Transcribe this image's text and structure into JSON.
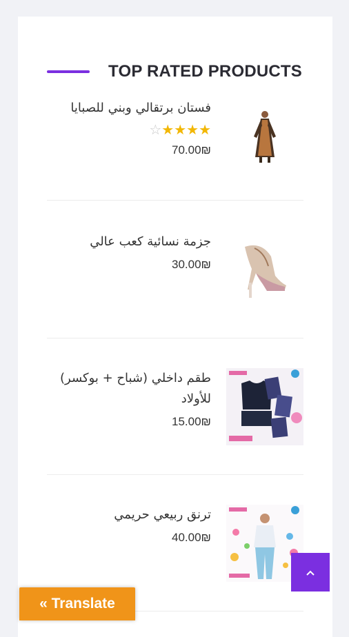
{
  "widget": {
    "title": "TOP RATED PRODUCTS"
  },
  "products": [
    {
      "name": "فستان برتقالي وبني للصبايا",
      "rating": 4,
      "rating_max": 5,
      "price": "70.00₪",
      "image_icon": "dress-image"
    },
    {
      "name": "جزمة نسائية كعب عالي",
      "price": "30.00₪",
      "image_icon": "high-heel-shoe-image"
    },
    {
      "name": "طقم داخلي (شباح + بوكسر) للأولاد",
      "price": "15.00₪",
      "image_icon": "kids-underwear-set-image"
    },
    {
      "name": "ترنق ربيعي حريمي",
      "price": "40.00₪",
      "image_icon": "tracksuit-image"
    }
  ],
  "translate_button": {
    "label": "« Translate"
  },
  "scroll_top": {
    "icon": "chevron-up-icon"
  },
  "colors": {
    "accent": "#7b2fe0",
    "translate_bg": "#f09419",
    "star": "#f2b705"
  }
}
